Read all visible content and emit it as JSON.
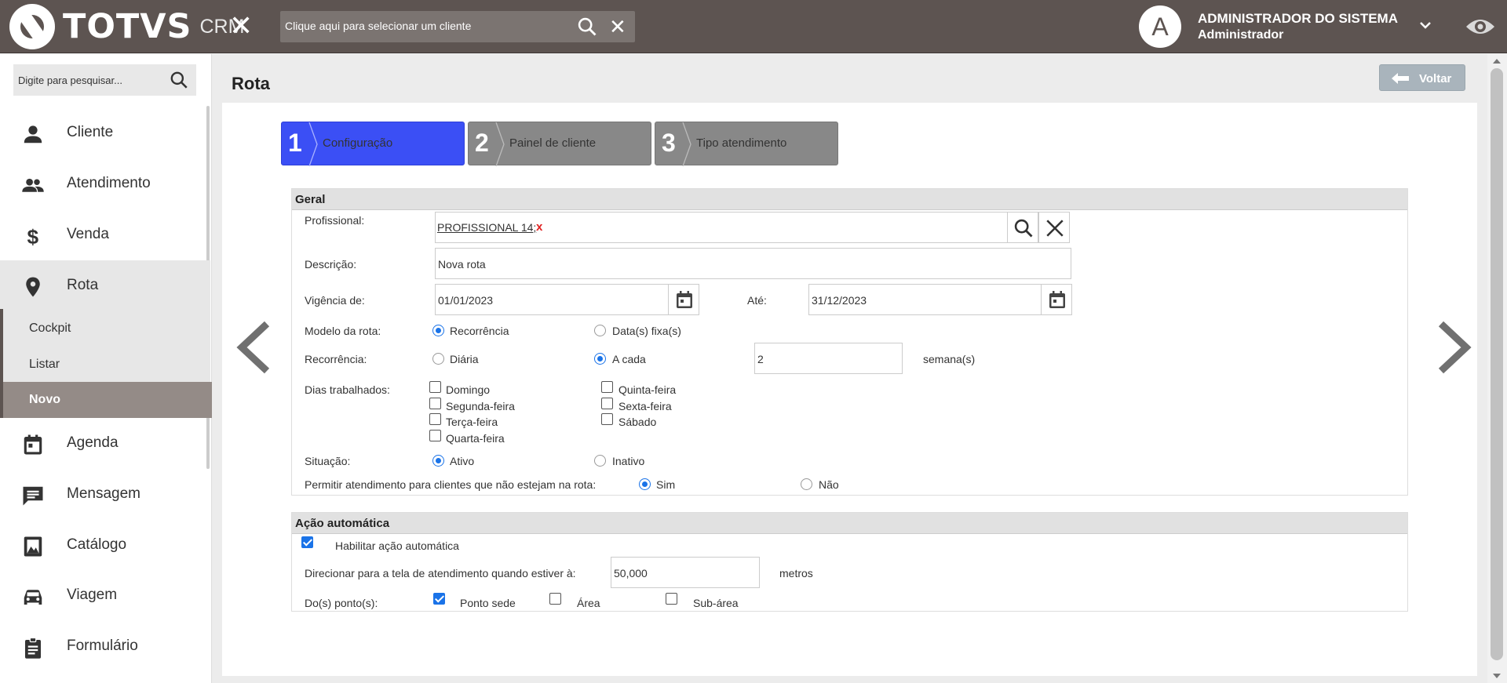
{
  "topbar": {
    "brand": "TOTVS",
    "brand_sub": "CRM",
    "client_placeholder": "Clique aqui para selecionar um cliente",
    "avatar_letter": "A",
    "user_name": "ADMINISTRADOR DO SISTEMA",
    "user_role": "Administrador"
  },
  "sidebar": {
    "search_placeholder": "Digite para pesquisar...",
    "items": [
      {
        "label": "Cliente",
        "icon": "person-icon"
      },
      {
        "label": "Atendimento",
        "icon": "people-icon"
      },
      {
        "label": "Venda",
        "icon": "dollar-icon"
      },
      {
        "label": "Rota",
        "icon": "location-pin-icon"
      },
      {
        "label": "Agenda",
        "icon": "calendar-icon"
      },
      {
        "label": "Mensagem",
        "icon": "message-icon"
      },
      {
        "label": "Catálogo",
        "icon": "book-icon"
      },
      {
        "label": "Viagem",
        "icon": "car-icon"
      },
      {
        "label": "Formulário",
        "icon": "clipboard-icon"
      }
    ],
    "submenu": [
      "Cockpit",
      "Listar",
      "Novo"
    ]
  },
  "page": {
    "title": "Rota",
    "back_label": "Voltar"
  },
  "steps": [
    {
      "num": "1",
      "label": "Configuração"
    },
    {
      "num": "2",
      "label": "Painel de cliente"
    },
    {
      "num": "3",
      "label": "Tipo atendimento"
    }
  ],
  "geral": {
    "title": "Geral",
    "profissional_label": "Profissional:",
    "profissional_value": "PROFISSIONAL 14;",
    "profissional_remove": "x",
    "descricao_label": "Descrição:",
    "descricao_value": "Nova rota",
    "vigencia_label": "Vigência de:",
    "vigencia_de": "01/01/2023",
    "ate_label": "Até:",
    "vigencia_ate": "31/12/2023",
    "modelo_label": "Modelo da rota:",
    "modelo_opt1": "Recorrência",
    "modelo_opt2": "Data(s) fixa(s)",
    "recorrencia_label": "Recorrência:",
    "recorrencia_opt1": "Diária",
    "recorrencia_opt2": "A cada",
    "recorrencia_value": "2",
    "recorrencia_unit": "semana(s)",
    "dias_label": "Dias trabalhados:",
    "dias": [
      "Domingo",
      "Segunda-feira",
      "Terça-feira",
      "Quarta-feira",
      "Quinta-feira",
      "Sexta-feira",
      "Sábado"
    ],
    "situacao_label": "Situação:",
    "situacao_opt1": "Ativo",
    "situacao_opt2": "Inativo",
    "permitir_label": "Permitir atendimento para clientes que não estejam na rota:",
    "permitir_opt1": "Sim",
    "permitir_opt2": "Não"
  },
  "acao": {
    "title": "Ação automática",
    "habilitar_label": "Habilitar ação automática",
    "direcionar_label": "Direcionar para a tela de atendimento quando estiver à:",
    "distancia_value": "50,000",
    "distancia_unit": "metros",
    "pontos_label": "Do(s) ponto(s):",
    "ponto_sede": "Ponto sede",
    "area": "Área",
    "sub_area": "Sub-área"
  }
}
